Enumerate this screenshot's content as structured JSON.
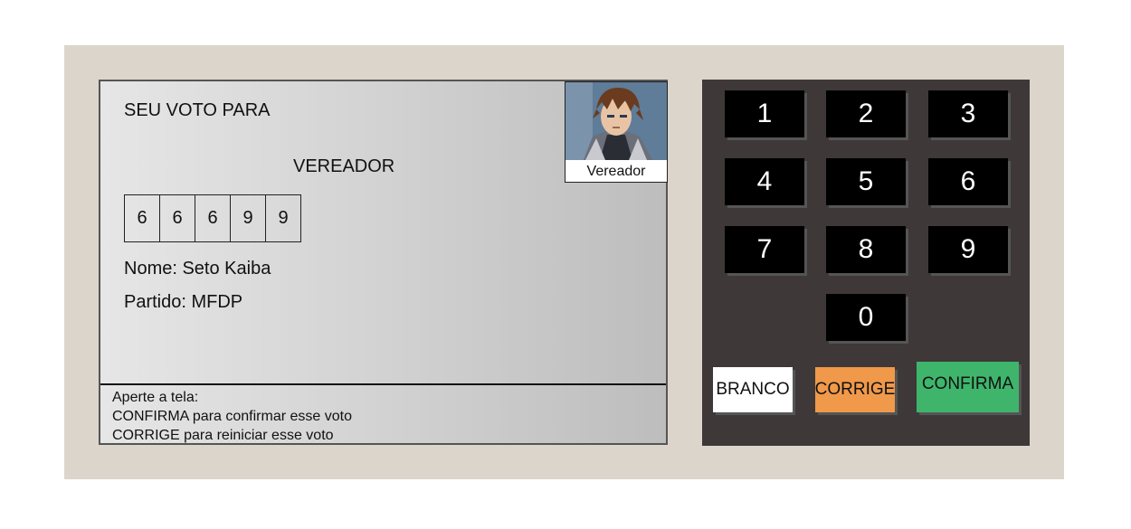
{
  "tela": {
    "titulo": "SEU VOTO PARA",
    "cargo": "VEREADOR",
    "digitos": [
      "6",
      "6",
      "6",
      "9",
      "9"
    ],
    "nome": "Nome: Seto Kaiba",
    "partido": "Partido: MFDP",
    "foto_legenda": "Vereador",
    "rodape": {
      "linha1": "Aperte a tela:",
      "linha2": "CONFIRMA para confirmar esse voto",
      "linha3": "CORRIGE para reiniciar esse voto"
    }
  },
  "teclado": {
    "teclas": [
      "1",
      "2",
      "3",
      "4",
      "5",
      "6",
      "7",
      "8",
      "9",
      "0"
    ],
    "branco": "BRANCO",
    "corrige": "CORRIGE",
    "confirma": "CONFIRMA"
  },
  "colors": {
    "urna_bg": "#dcd5cb",
    "teclado_bg": "#3e3839",
    "tecla_bg": "#000000",
    "branco_bg": "#ffffff",
    "corrige_bg": "#f0994a",
    "confirma_bg": "#3fb56c"
  }
}
